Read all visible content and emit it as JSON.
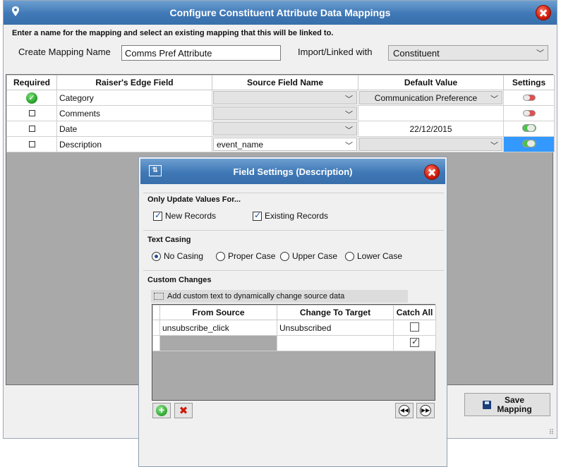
{
  "main": {
    "title": "Configure Constituent Attribute Data Mappings",
    "instruction": "Enter a name for the mapping and select an existing mapping that this will be linked to.",
    "create_label": "Create Mapping Name",
    "mapping_name": "Comms Pref Attribute",
    "import_label": "Import/Linked with",
    "import_value": "Constituent",
    "columns": {
      "required": "Required",
      "field": "Raiser's Edge Field",
      "source": "Source Field Name",
      "default": "Default Value",
      "settings": "Settings"
    },
    "rows": [
      {
        "field": "Category",
        "source": "",
        "default": "Communication Preference"
      },
      {
        "field": "Comments",
        "source": "",
        "default": ""
      },
      {
        "field": "Date",
        "source": "",
        "default": "22/12/2015"
      },
      {
        "field": "Description",
        "source": "event_name",
        "default": ""
      }
    ],
    "save_label_1": "Save",
    "save_label_2": "Mapping"
  },
  "dialog": {
    "title": "Field Settings (Description)",
    "only_update": "Only Update Values For...",
    "new_records": "New Records",
    "existing_records": "Existing Records",
    "text_casing": "Text Casing",
    "casing_options": [
      "No Casing",
      "Proper Case",
      "Upper Case",
      "Lower Case"
    ],
    "custom_changes": "Custom Changes",
    "custom_hint": "Add custom text to dynamically change source data",
    "columns": {
      "from": "From Source",
      "to": "Change To Target",
      "catch": "Catch All"
    },
    "rows": [
      {
        "from": "unsubscribe_click",
        "to": "Unsubscribed"
      },
      {
        "from": "",
        "to": ""
      }
    ]
  },
  "colors": {
    "title_blue": "#3f78b6",
    "selection_blue": "#3399ff"
  }
}
